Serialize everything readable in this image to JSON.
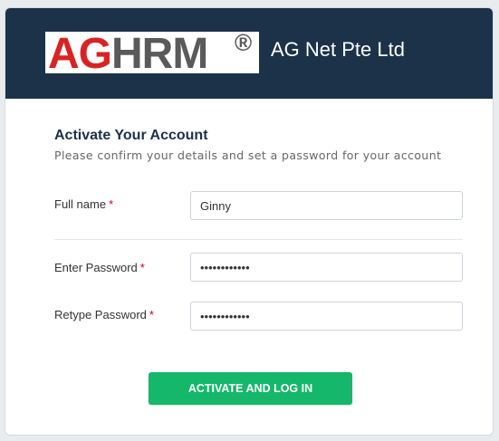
{
  "header": {
    "logo": {
      "ag": "AG",
      "hrm": "HRM",
      "registered": "®"
    },
    "company_name": "AG Net Pte Ltd"
  },
  "form": {
    "title": "Activate Your Account",
    "subtitle": "Please confirm your details and set a password for your account",
    "required_marker": "*",
    "fields": {
      "full_name": {
        "label": "Full name",
        "value": "Ginny"
      },
      "password": {
        "label": "Enter Password",
        "value": "••••••••••••"
      },
      "retype_password": {
        "label": "Retype Password",
        "value": "••••••••••••"
      }
    },
    "submit_label": "ACTIVATE AND LOG IN"
  },
  "colors": {
    "header_bg": "#1b3249",
    "logo_red": "#d92323",
    "logo_gray": "#5a5a5a",
    "button_green": "#15b86a",
    "required_red": "#d0021b"
  }
}
